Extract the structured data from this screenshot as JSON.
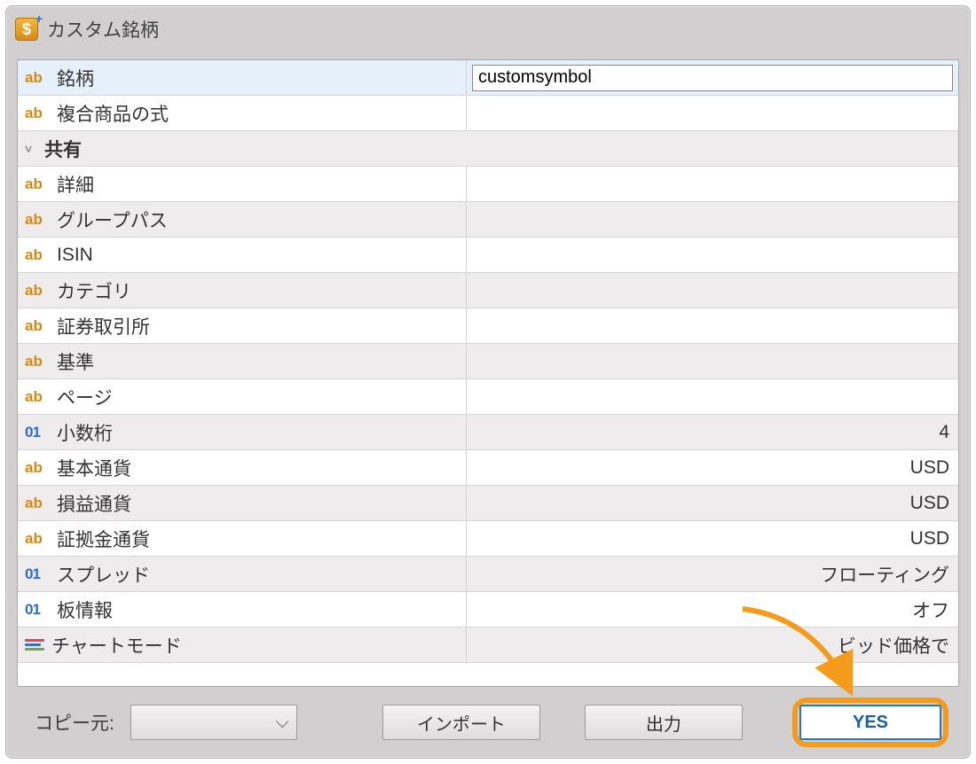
{
  "window": {
    "title": "カスタム銘柄"
  },
  "rows": [
    {
      "type": "ab",
      "label": "銘柄",
      "value": "customsymbol",
      "editing": true
    },
    {
      "type": "ab",
      "label": "複合商品の式",
      "value": ""
    },
    {
      "type": "group",
      "label": "共有"
    },
    {
      "type": "ab",
      "label": "詳細",
      "value": ""
    },
    {
      "type": "ab",
      "label": "グループパス",
      "value": ""
    },
    {
      "type": "ab",
      "label": "ISIN",
      "value": ""
    },
    {
      "type": "ab",
      "label": "カテゴリ",
      "value": ""
    },
    {
      "type": "ab",
      "label": "証券取引所",
      "value": ""
    },
    {
      "type": "ab",
      "label": "基準",
      "value": ""
    },
    {
      "type": "ab",
      "label": "ページ",
      "value": ""
    },
    {
      "type": "01",
      "label": "小数桁",
      "value": "4"
    },
    {
      "type": "ab",
      "label": "基本通貨",
      "value": "USD"
    },
    {
      "type": "ab",
      "label": "損益通貨",
      "value": "USD"
    },
    {
      "type": "ab",
      "label": "証拠金通貨",
      "value": "USD"
    },
    {
      "type": "01",
      "label": "スプレッド",
      "value": "フローティング"
    },
    {
      "type": "01",
      "label": "板情報",
      "value": "オフ"
    },
    {
      "type": "chart",
      "label": "チャートモード",
      "value": "ビッド価格で"
    }
  ],
  "footer": {
    "copy_from_label": "コピー元:",
    "import_label": "インポート",
    "export_label": "出力",
    "yes_label": "YES"
  }
}
